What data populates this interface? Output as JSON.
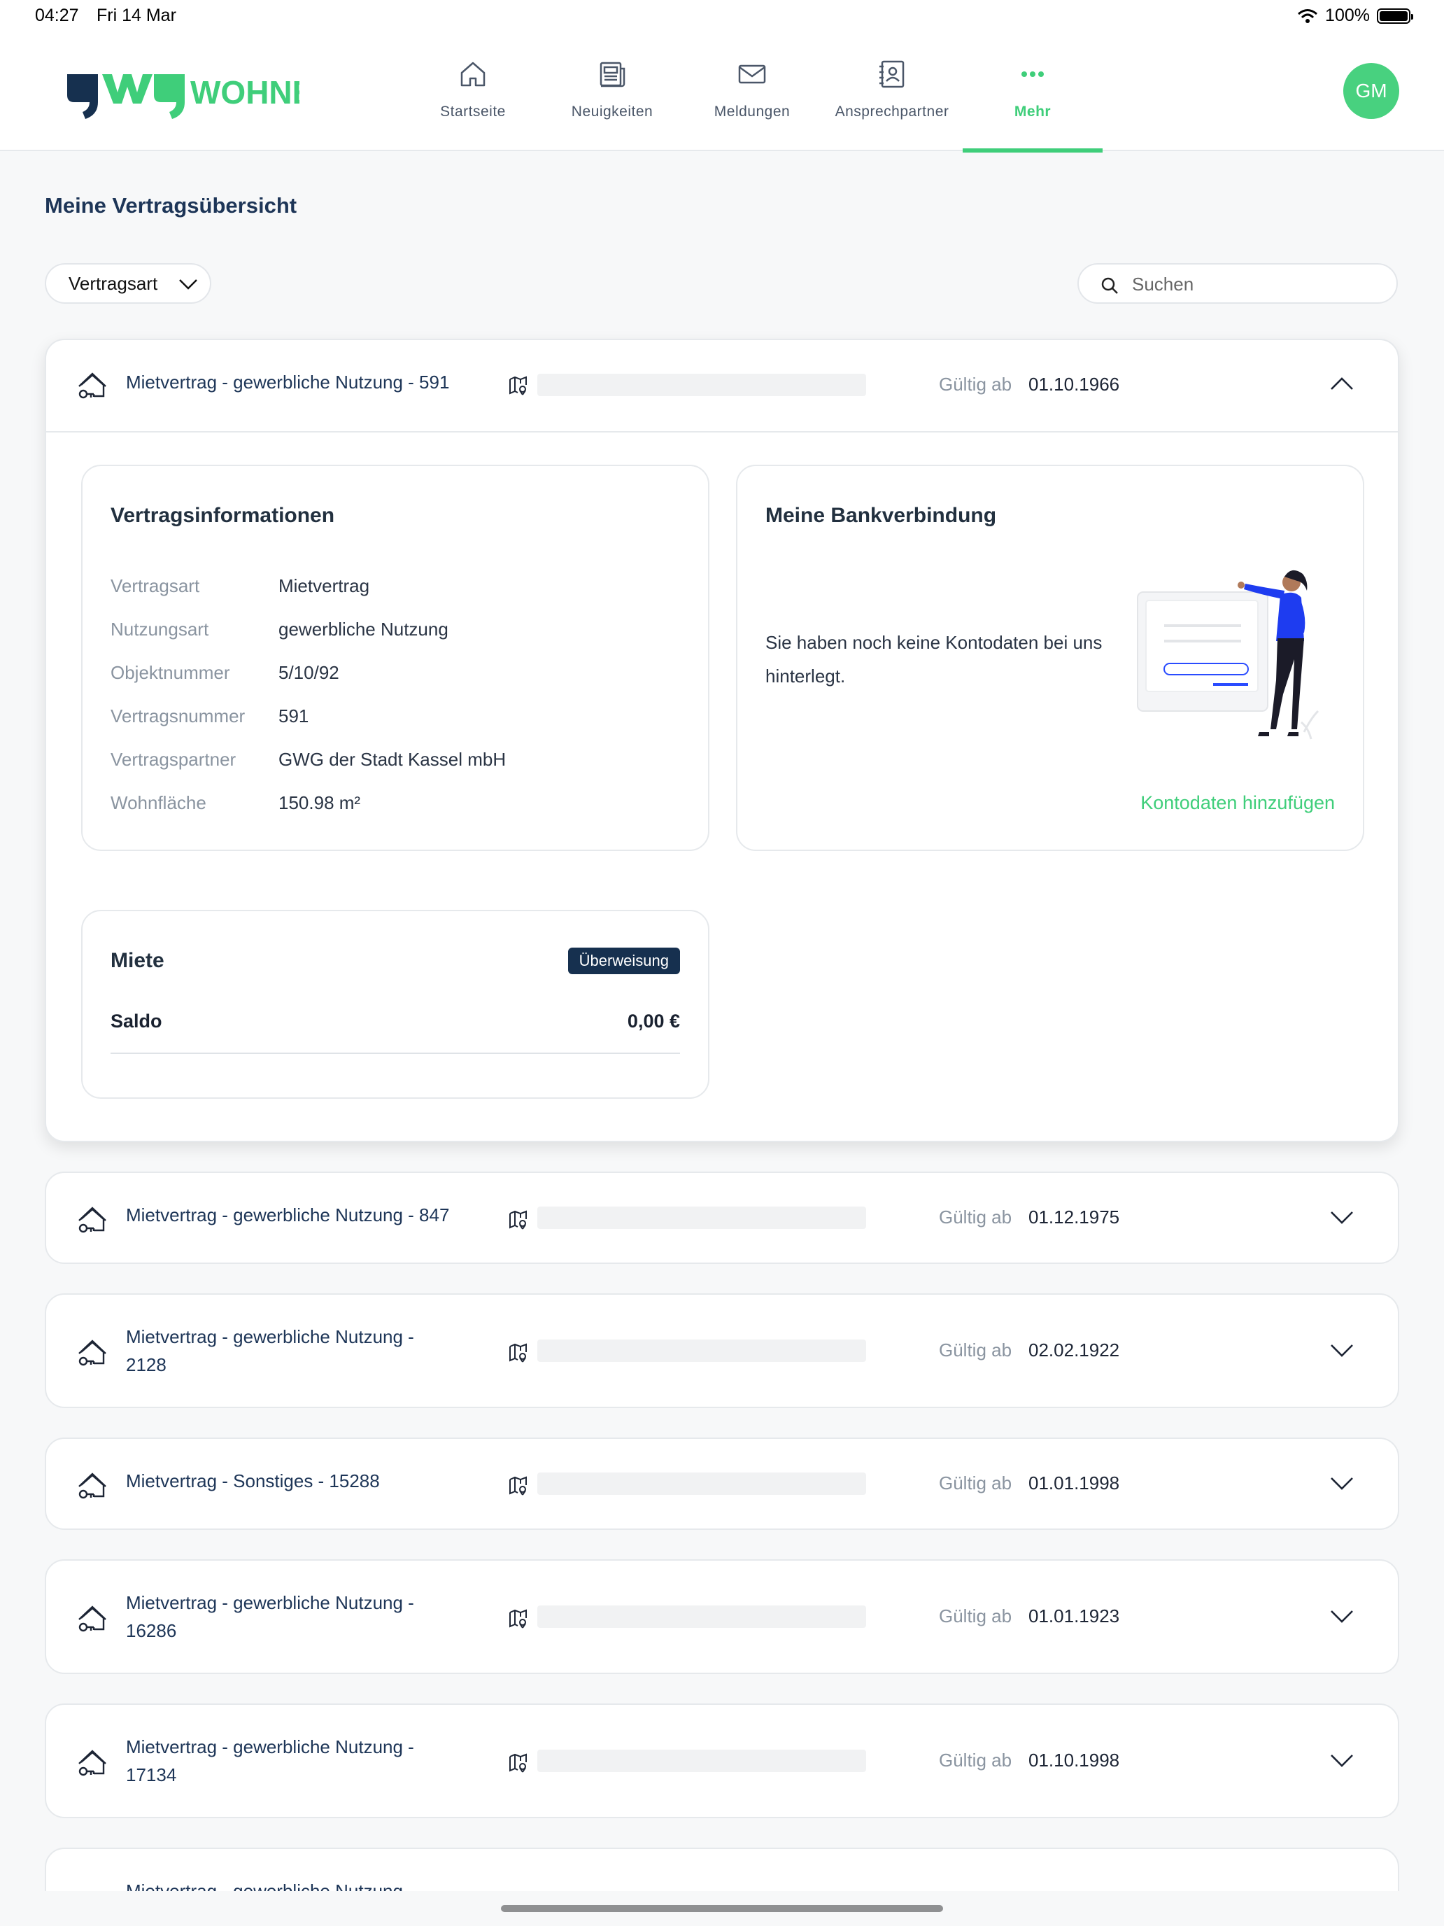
{
  "status": {
    "time": "04:27",
    "date": "Fri 14 Mar",
    "battery": "100%"
  },
  "app": {
    "brand": "WOHNEN",
    "brand_color": "#3fce7a"
  },
  "nav": {
    "items": [
      {
        "label": "Startseite",
        "icon": "home-icon"
      },
      {
        "label": "Neuigkeiten",
        "icon": "newspaper-icon"
      },
      {
        "label": "Meldungen",
        "icon": "envelope-icon"
      },
      {
        "label": "Ansprechpartner",
        "icon": "contacts-book-icon"
      },
      {
        "label": "Mehr",
        "icon": "more-dots-icon",
        "active": true
      }
    ],
    "avatar_initials": "GM"
  },
  "page": {
    "title": "Meine Vertragsübersicht"
  },
  "filter": {
    "label": "Vertragsart"
  },
  "search": {
    "placeholder": "Suchen"
  },
  "labels": {
    "valid_from": "Gültig ab"
  },
  "contracts": [
    {
      "title": "Mietvertrag - gewerbliche Nutzung - 591",
      "valid_from": "01.10.1966",
      "expanded": true
    },
    {
      "title": "Mietvertrag - gewerbliche Nutzung - 847",
      "valid_from": "01.12.1975"
    },
    {
      "title": "Mietvertrag - gewerbliche Nutzung - 2128",
      "valid_from": "02.02.1922"
    },
    {
      "title": "Mietvertrag - Sonstiges - 15288",
      "valid_from": "01.01.1998"
    },
    {
      "title": "Mietvertrag - gewerbliche Nutzung - 16286",
      "valid_from": "01.01.1923"
    },
    {
      "title": "Mietvertrag - gewerbliche Nutzung - 17134",
      "valid_from": "01.10.1998"
    },
    {
      "title": "Mietvertrag - gewerbliche Nutzung"
    }
  ],
  "details": {
    "info_title": "Vertragsinformationen",
    "rows": [
      {
        "key": "Vertragsart",
        "value": "Mietvertrag"
      },
      {
        "key": "Nutzungsart",
        "value": "gewerbliche Nutzung"
      },
      {
        "key": "Objektnummer",
        "value": "5/10/92"
      },
      {
        "key": "Vertragsnummer",
        "value": "591"
      },
      {
        "key": "Vertragspartner",
        "value": "GWG der Stadt Kassel mbH"
      },
      {
        "key": "Wohnfläche",
        "value": "150.98 m²"
      }
    ],
    "bank_title": "Meine Bankverbindung",
    "bank_text": "Sie haben noch keine Kontodaten bei uns hinterlegt.",
    "bank_link": "Kontodaten hinzufügen",
    "rent_title": "Miete",
    "rent_badge": "Überweisung",
    "saldo_label": "Saldo",
    "saldo_value": "0,00 €"
  }
}
